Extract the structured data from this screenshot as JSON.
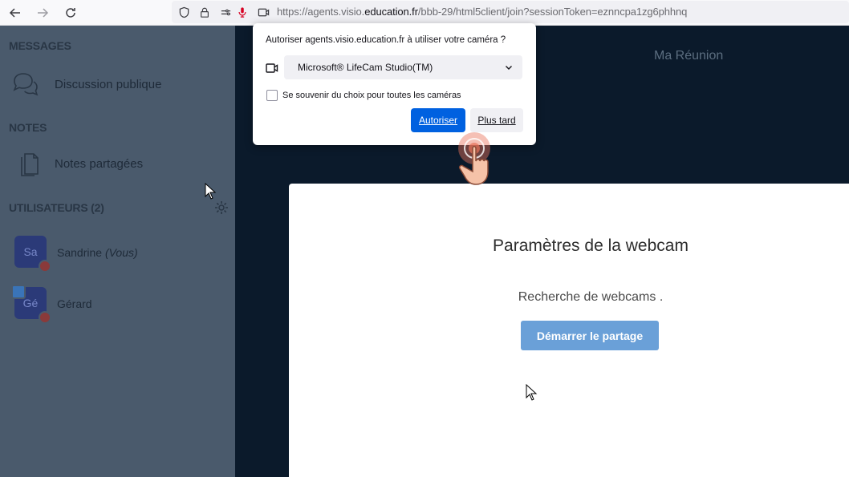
{
  "browser": {
    "url_prefix": "https://agents.visio.",
    "url_domain": "education.fr",
    "url_suffix": "/bbb-29/html5client/join?sessionToken=eznncpa1zg6phhnq"
  },
  "sidebar": {
    "messages_header": "MESSAGES",
    "public_chat_label": "Discussion publique",
    "notes_header": "NOTES",
    "shared_notes_label": "Notes partagées",
    "users_header": "UTILISATEURS (2)",
    "users": [
      {
        "initials": "Sa",
        "name": "Sandrine",
        "suffix": "(Vous)"
      },
      {
        "initials": "Gé",
        "name": "Gérard",
        "suffix": ""
      }
    ]
  },
  "main": {
    "meeting_title": "Ma Réunion",
    "webcam_modal": {
      "title": "Paramètres de la webcam",
      "status": "Recherche de webcams .",
      "start_button": "Démarrer le partage"
    }
  },
  "permission_popup": {
    "message": "Autoriser agents.visio.education.fr à utiliser votre caméra ?",
    "camera_device": "Microsoft® LifeCam Studio(TM)",
    "remember_label": "Se souvenir du choix pour toutes les caméras",
    "remember_checked": false,
    "allow_button": "Autoriser",
    "later_button": "Plus tard"
  },
  "colors": {
    "accent_blue": "#0061e0",
    "start_button": "#6aa0d8",
    "sidebar_bg": "#4a5a6c",
    "main_bg": "#0b1a2b"
  }
}
